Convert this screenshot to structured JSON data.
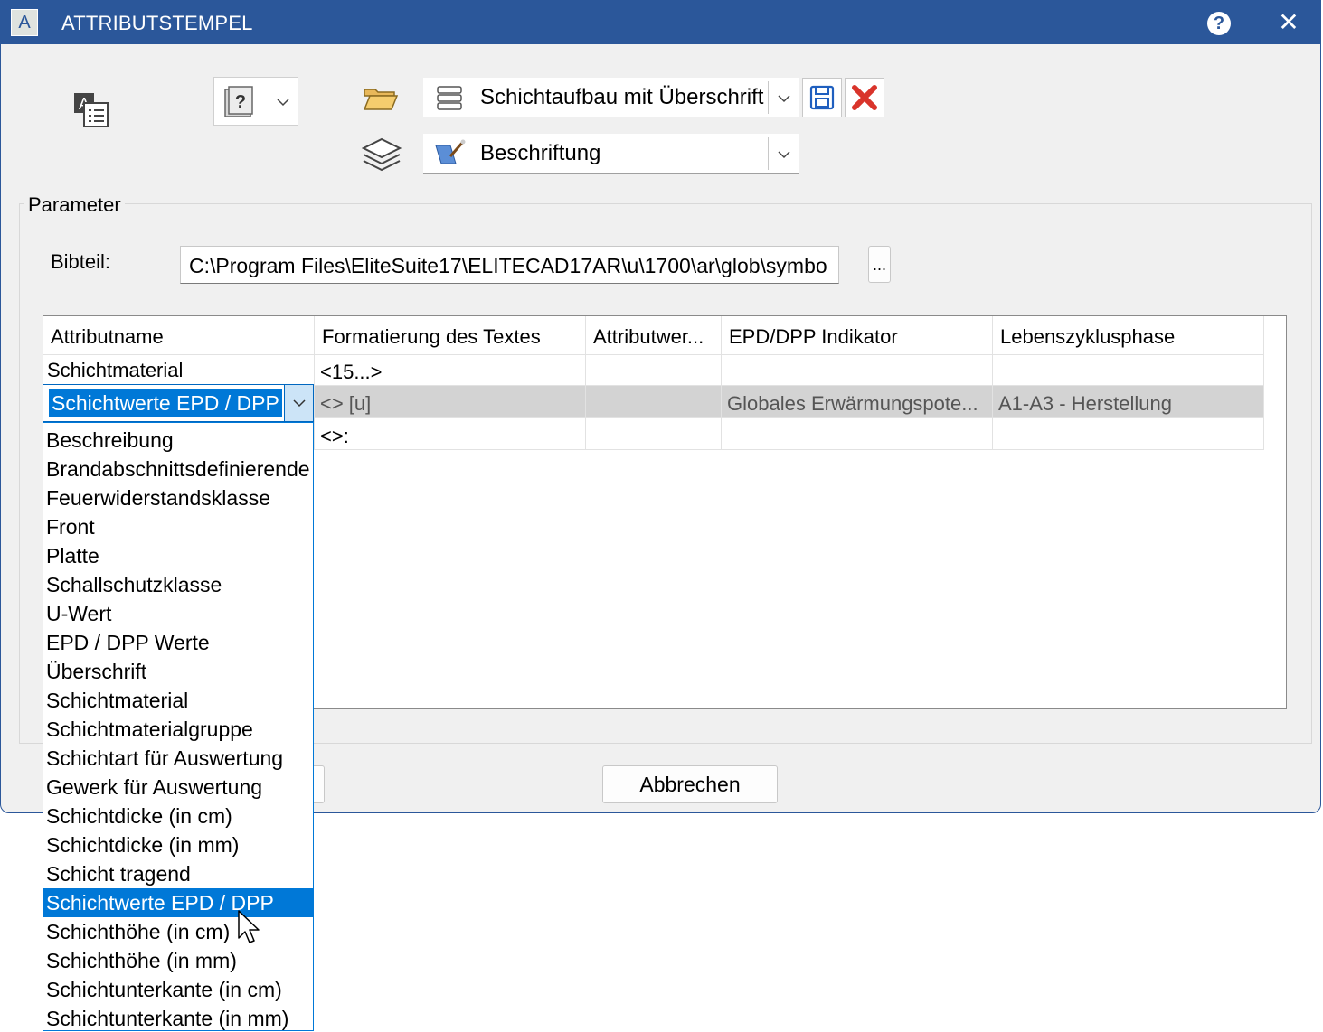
{
  "window": {
    "title": "ATTRIBUTSTEMPEL"
  },
  "toolbar": {
    "template_select": "Schichtaufbau mit Überschrift",
    "layer_select": "Beschriftung",
    "style_dropdown_glyph": "?"
  },
  "parameter": {
    "group_label": "Parameter",
    "bibteil_label": "Bibteil:",
    "bibteil_path": "C:\\Program Files\\EliteSuite17\\ELITECAD17AR\\u\\1700\\ar\\glob\\symbo",
    "browse_label": "..."
  },
  "grid": {
    "headers": [
      "Attributname",
      "Formatierung des Textes",
      "Attributwer...",
      "EPD/DPP Indikator",
      "Lebenszyklusphase"
    ],
    "rows": [
      {
        "name": "Schichtmaterial",
        "format": "<15...>",
        "value": "",
        "indicator": "",
        "phase": ""
      },
      {
        "name": "Schichtwerte EPD / DPP",
        "format": "<> [u]",
        "value": "",
        "indicator": "Globales Erwärmungspote...",
        "phase": "A1-A3 - Herstellung"
      },
      {
        "name": "",
        "format": "<>:",
        "value": "",
        "indicator": "",
        "phase": ""
      }
    ]
  },
  "dropdown": {
    "current": "Schichtwerte EPD / DPP",
    "options": [
      "Beschreibung",
      "Brandabschnittsdefinierende",
      "Feuerwiderstandsklasse",
      "Front",
      "Platte",
      "Schallschutzklasse",
      "U-Wert",
      "EPD / DPP Werte",
      "Überschrift",
      "Schichtmaterial",
      "Schichtmaterialgruppe",
      "Schichtart für Auswertung",
      "Gewerk für Auswertung",
      "Schichtdicke (in cm)",
      "Schichtdicke (in mm)",
      "Schicht tragend",
      "Schichtwerte EPD / DPP",
      "Schichthöhe (in cm)",
      "Schichthöhe (in mm)",
      "Schichtunterkante (in cm)",
      "Schichtunterkante (in mm)"
    ],
    "selected": "Schichtwerte EPD / DPP"
  },
  "buttons": {
    "cancel": "Abbrechen"
  },
  "colors": {
    "titlebar": "#2b579a",
    "selection": "#0078d7",
    "row_selected": "#d3d3d3"
  }
}
